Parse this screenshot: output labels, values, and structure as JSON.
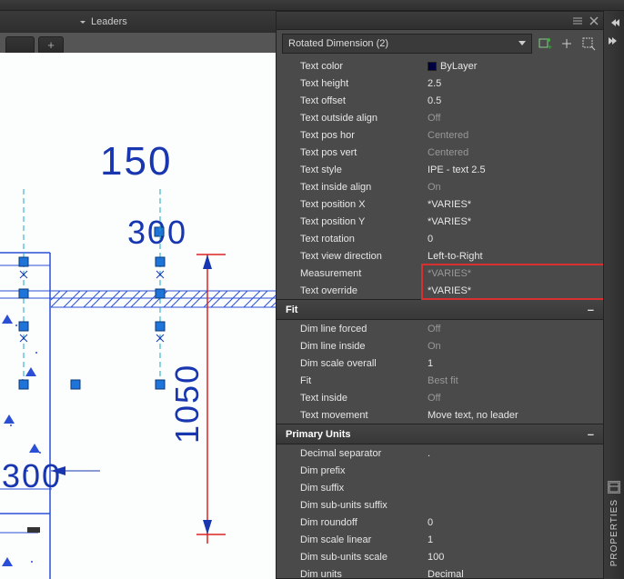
{
  "ribbon": {
    "group_label": "Leaders"
  },
  "selector": {
    "text": "Rotated Dimension (2)"
  },
  "canvas_dims": {
    "d150": "150",
    "d300a": "300",
    "d1050": "1050",
    "d300b": "300"
  },
  "sections": {
    "text": {
      "rows": [
        {
          "k": "text_color",
          "label": "Text color",
          "value": "ByLayer",
          "ghost": false,
          "swatch": true
        },
        {
          "k": "text_height",
          "label": "Text height",
          "value": "2.5",
          "ghost": false
        },
        {
          "k": "text_offset",
          "label": "Text offset",
          "value": "0.5",
          "ghost": false
        },
        {
          "k": "text_outside_align",
          "label": "Text outside align",
          "value": "Off",
          "ghost": true
        },
        {
          "k": "text_pos_hor",
          "label": "Text pos hor",
          "value": "Centered",
          "ghost": true
        },
        {
          "k": "text_pos_vert",
          "label": "Text pos vert",
          "value": "Centered",
          "ghost": true
        },
        {
          "k": "text_style",
          "label": "Text style",
          "value": "IPE - text 2.5",
          "ghost": false
        },
        {
          "k": "text_inside_align",
          "label": "Text inside align",
          "value": "On",
          "ghost": true
        },
        {
          "k": "text_position_x",
          "label": "Text position X",
          "value": "*VARIES*",
          "ghost": false
        },
        {
          "k": "text_position_y",
          "label": "Text position Y",
          "value": "*VARIES*",
          "ghost": false
        },
        {
          "k": "text_rotation",
          "label": "Text rotation",
          "value": "0",
          "ghost": false
        },
        {
          "k": "text_view_direction",
          "label": "Text view direction",
          "value": "Left-to-Right",
          "ghost": false
        },
        {
          "k": "measurement",
          "label": "Measurement",
          "value": "*VARIES*",
          "ghost": true
        },
        {
          "k": "text_override",
          "label": "Text override",
          "value": "*VARIES*",
          "ghost": false
        }
      ]
    },
    "fit": {
      "title": "Fit",
      "rows": [
        {
          "k": "dim_line_forced",
          "label": "Dim line forced",
          "value": "Off",
          "ghost": true
        },
        {
          "k": "dim_line_inside",
          "label": "Dim line inside",
          "value": "On",
          "ghost": true
        },
        {
          "k": "dim_scale_overall",
          "label": "Dim scale overall",
          "value": "1",
          "ghost": false
        },
        {
          "k": "fit",
          "label": "Fit",
          "value": "Best fit",
          "ghost": true
        },
        {
          "k": "text_inside",
          "label": "Text inside",
          "value": "Off",
          "ghost": true
        },
        {
          "k": "text_movement",
          "label": "Text movement",
          "value": "Move text, no leader",
          "ghost": false
        }
      ]
    },
    "primary": {
      "title": "Primary Units",
      "rows": [
        {
          "k": "decimal_separator",
          "label": "Decimal separator",
          "value": ".",
          "ghost": false
        },
        {
          "k": "dim_prefix",
          "label": "Dim prefix",
          "value": "",
          "ghost": false
        },
        {
          "k": "dim_suffix",
          "label": "Dim suffix",
          "value": "",
          "ghost": false
        },
        {
          "k": "dim_sub_units_suffix",
          "label": "Dim sub-units suffix",
          "value": "",
          "ghost": false
        },
        {
          "k": "dim_roundoff",
          "label": "Dim roundoff",
          "value": "0",
          "ghost": false
        },
        {
          "k": "dim_scale_linear",
          "label": "Dim scale linear",
          "value": "1",
          "ghost": false
        },
        {
          "k": "dim_sub_units_scale",
          "label": "Dim sub-units scale",
          "value": "100",
          "ghost": false
        },
        {
          "k": "dim_units",
          "label": "Dim units",
          "value": "Decimal",
          "ghost": false
        }
      ]
    }
  },
  "gutter": {
    "properties_label": "PROPERTIES"
  }
}
